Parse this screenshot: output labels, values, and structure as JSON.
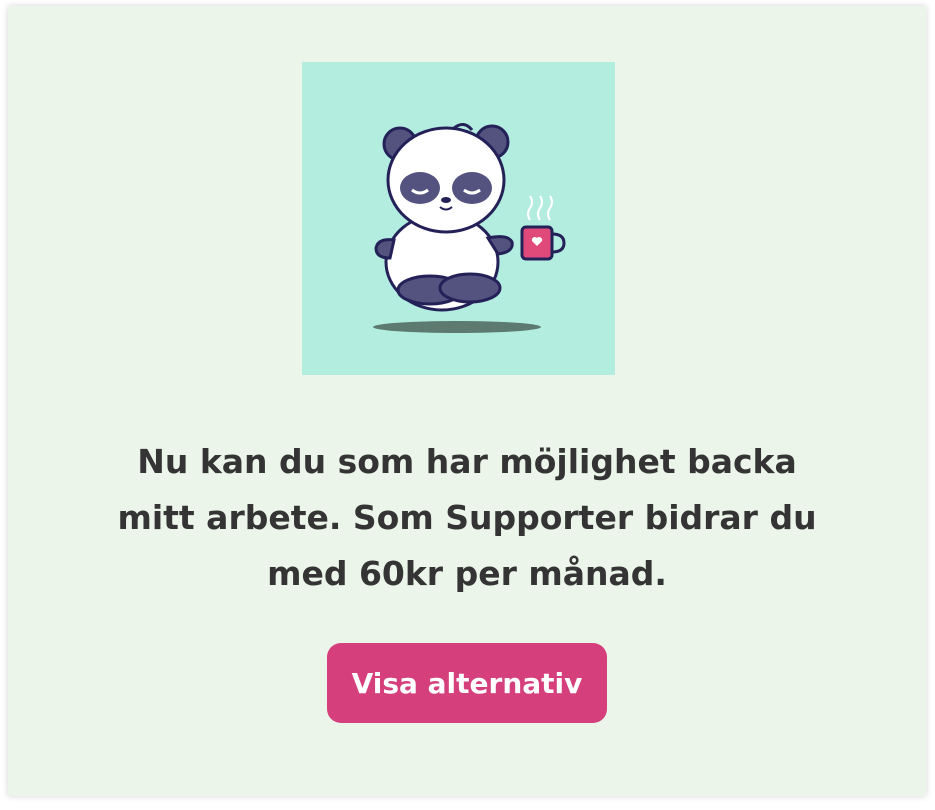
{
  "hero": {
    "illustration": "meditating-panda-with-coffee-mug",
    "background_color": "#b3ede0"
  },
  "message": {
    "text": "Nu kan du som har möjlighet backa mitt arbete. Som Supporter bidrar du med 60kr per månad."
  },
  "cta": {
    "label": "Visa alternativ",
    "color": "#d53f7c"
  },
  "colors": {
    "card_background": "#ebf5e9",
    "text": "#343434"
  }
}
